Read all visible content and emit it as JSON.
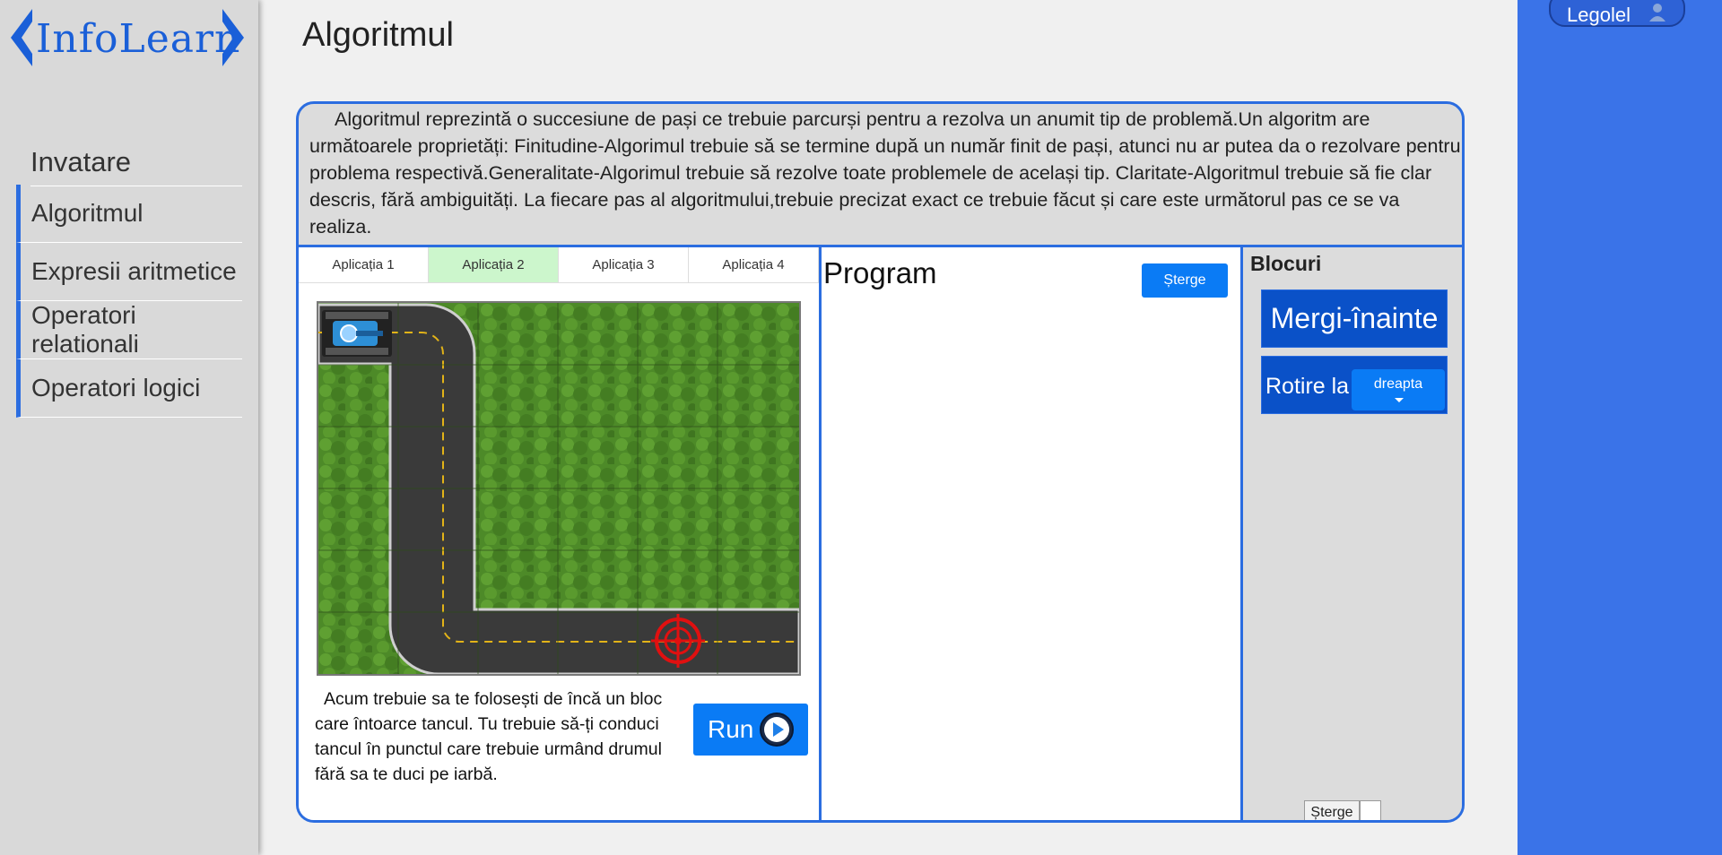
{
  "brand": {
    "logo_text": "InfoLearn",
    "color": "#1a5fd8"
  },
  "sidebar": {
    "section_title": "Invatare",
    "items": [
      {
        "label": "Algoritmul"
      },
      {
        "label": "Expresii aritmetice"
      },
      {
        "label": "Operatori relationali"
      },
      {
        "label": "Operatori logici"
      }
    ]
  },
  "user": {
    "name": "Legolel",
    "icon": "user-icon"
  },
  "page": {
    "title": "Algoritmul"
  },
  "intro": {
    "text": "Algoritmul reprezintă o succesiune de pași ce trebuie parcurși pentru a rezolva un anumit tip de problemă.Un algoritm are următoarele proprietăți: Finitudine-Algorimul trebuie să se termine după un număr finit de pași, atunci nu ar putea da o rezolvare pentru problema respectivă.Generalitate-Algorimul trebuie să rezolve toate problemele de același tip. Claritate-Algoritmul trebuie să fie clar descris, fără ambiguități. La fiecare pas al algoritmului,trebuie precizat exact ce trebuie făcut și care este următorul pas ce se va realiza."
  },
  "tabs": [
    {
      "label": "Aplicația 1",
      "active": false
    },
    {
      "label": "Aplicația 2",
      "active": true
    },
    {
      "label": "Aplicația 3",
      "active": false
    },
    {
      "label": "Aplicația 4",
      "active": false
    }
  ],
  "game": {
    "grid_cols": 6,
    "grid_rows": 6,
    "grass_color": "#4f8a2a",
    "road_color": "#3a3a3a"
  },
  "hint": "Acum trebuie sa te folosești de încă un bloc care întoarce tancul. Tu trebuie să-ți conduci tancul în punctul care trebuie urmând drumul fără sa te duci pe iarbă.",
  "run_button": {
    "label": "Run"
  },
  "program": {
    "title": "Program",
    "clear_label": "Șterge"
  },
  "blocks": {
    "title": "Blocuri",
    "forward_label": "Mergi-înainte",
    "rotate_label": "Rotire la",
    "rotate_value": "dreapta",
    "small_clear_label": "Șterge"
  },
  "colors": {
    "accent": "#2b6de0",
    "button": "#0a7bf5",
    "block": "#0a51c8",
    "right_panel": "#3a73e8"
  }
}
